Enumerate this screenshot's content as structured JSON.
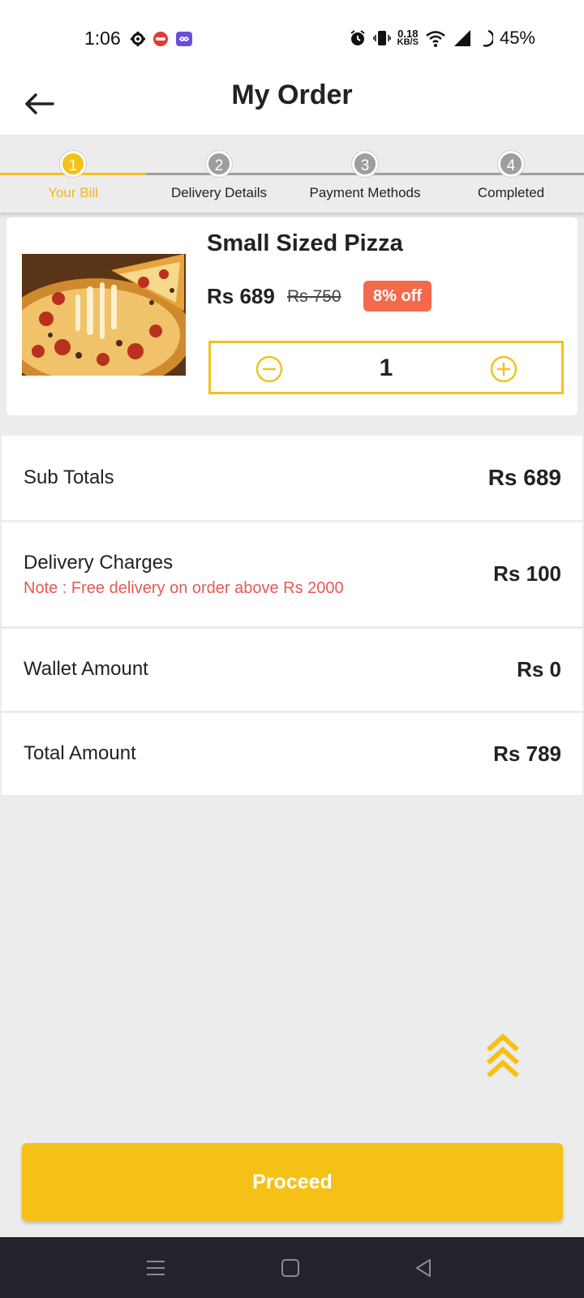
{
  "status_bar": {
    "time": "1:06",
    "net_speed_value": "0.18",
    "net_speed_unit": "KB/S",
    "battery": "45%"
  },
  "header": {
    "title": "My Order"
  },
  "stepper": {
    "active_index": 0,
    "steps": [
      {
        "number": "1",
        "label": "Your Bill"
      },
      {
        "number": "2",
        "label": "Delivery Details"
      },
      {
        "number": "3",
        "label": "Payment Methods"
      },
      {
        "number": "4",
        "label": "Completed"
      }
    ]
  },
  "product": {
    "name": "Small Sized Pizza",
    "price": "Rs 689",
    "old_price": "Rs 750",
    "discount": "8% off",
    "quantity": "1"
  },
  "summary": {
    "sub_totals": {
      "label": "Sub Totals",
      "value": "Rs 689"
    },
    "delivery": {
      "label": "Delivery Charges",
      "value": "Rs 100",
      "note": "Note : Free delivery on order above Rs 2000"
    },
    "wallet": {
      "label": "Wallet Amount",
      "value": "Rs 0"
    },
    "total": {
      "label": "Total Amount",
      "value": "Rs 789"
    }
  },
  "proceed_label": "Proceed",
  "colors": {
    "accent": "#f5c117",
    "discount": "#f26a4b",
    "note": "#e35a56",
    "background": "#ececec"
  }
}
